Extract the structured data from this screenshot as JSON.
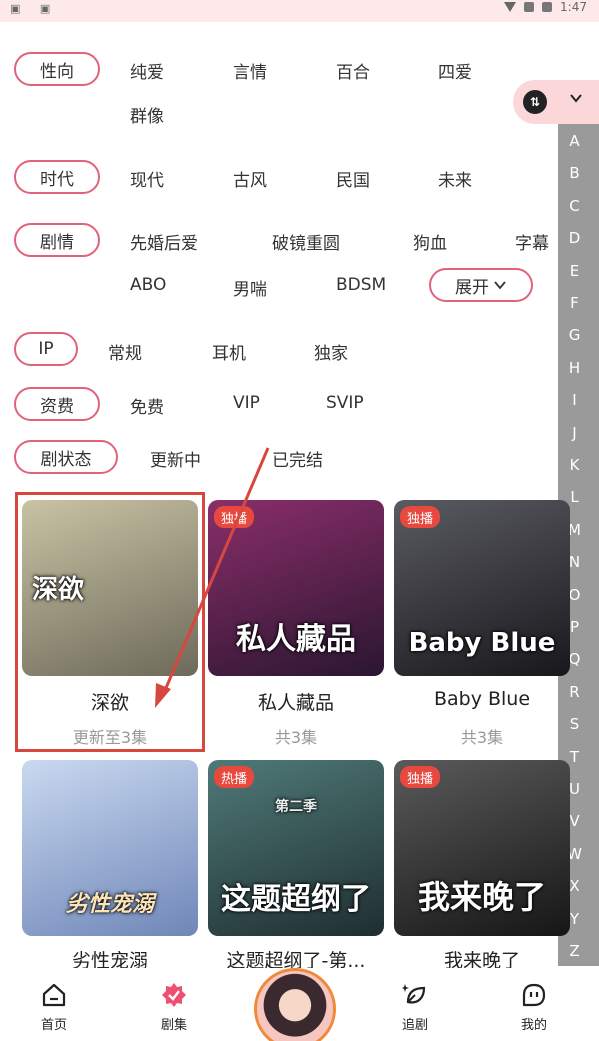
{
  "status_bar": {
    "left_icons": "▣ ▣",
    "time": "1:47"
  },
  "filters": {
    "orientation": {
      "label": "性向",
      "options": [
        "纯爱",
        "言情",
        "百合",
        "四爱",
        "群像"
      ]
    },
    "era": {
      "label": "时代",
      "options": [
        "现代",
        "古风",
        "民国",
        "未来"
      ]
    },
    "plot": {
      "label": "剧情",
      "options": [
        "先婚后爱",
        "破镜重圆",
        "狗血",
        "字幕",
        "ABO",
        "男喘",
        "BDSM"
      ],
      "expand_label": "展开"
    },
    "ip": {
      "label": "IP",
      "options": [
        "常规",
        "耳机",
        "独家"
      ]
    },
    "fee": {
      "label": "资费",
      "options": [
        "免费",
        "VIP",
        "SVIP"
      ]
    },
    "status": {
      "label": "剧状态",
      "options": [
        "更新中",
        "已完结"
      ]
    }
  },
  "sort": {
    "icon_text": "⇅"
  },
  "alpha_index": [
    "A",
    "B",
    "C",
    "D",
    "E",
    "F",
    "G",
    "H",
    "I",
    "J",
    "K",
    "L",
    "M",
    "N",
    "O",
    "P",
    "Q",
    "R",
    "S",
    "T",
    "U",
    "V",
    "W",
    "X",
    "Y",
    "Z"
  ],
  "dramas": [
    {
      "title": "深欲",
      "sub": "更新至3集",
      "badge": "",
      "cover_text": "深欲",
      "colors": [
        "#c9c3a4",
        "#6d6a5a"
      ]
    },
    {
      "title": "私人藏品",
      "sub": "共3集",
      "badge": "独播",
      "cover_text": "私人藏品",
      "colors": [
        "#8b2e6a",
        "#2a1630"
      ]
    },
    {
      "title": "Baby Blue",
      "sub": "共3集",
      "badge": "独播",
      "cover_text": "Baby Blue",
      "colors": [
        "#5a5a62",
        "#18181c"
      ]
    },
    {
      "title": "劣性宠溺",
      "sub": "",
      "badge": "",
      "cover_text": "劣性宠溺",
      "colors": [
        "#c9d9f0",
        "#6f86b8"
      ]
    },
    {
      "title": "这题超纲了-第...",
      "sub": "",
      "badge": "热播",
      "cover_text": "这题超纲了",
      "cover_subtext": "第二季",
      "colors": [
        "#4f7a78",
        "#1f2e30"
      ]
    },
    {
      "title": "我来晚了",
      "sub": "",
      "badge": "独播",
      "cover_text": "我来晚了",
      "colors": [
        "#5a5a5a",
        "#161616"
      ]
    }
  ],
  "bottom_nav": [
    {
      "label": "首页",
      "icon": "home-icon"
    },
    {
      "label": "剧集",
      "icon": "drama-icon"
    },
    {
      "label": "",
      "icon": "avatar"
    },
    {
      "label": "追剧",
      "icon": "follow-icon"
    },
    {
      "label": "我的",
      "icon": "profile-icon"
    }
  ],
  "colors": {
    "accent": "#e0637b",
    "badge": "#e8493f",
    "highlight": "#d8473f",
    "alpha_bar": "#9a9a9a"
  }
}
